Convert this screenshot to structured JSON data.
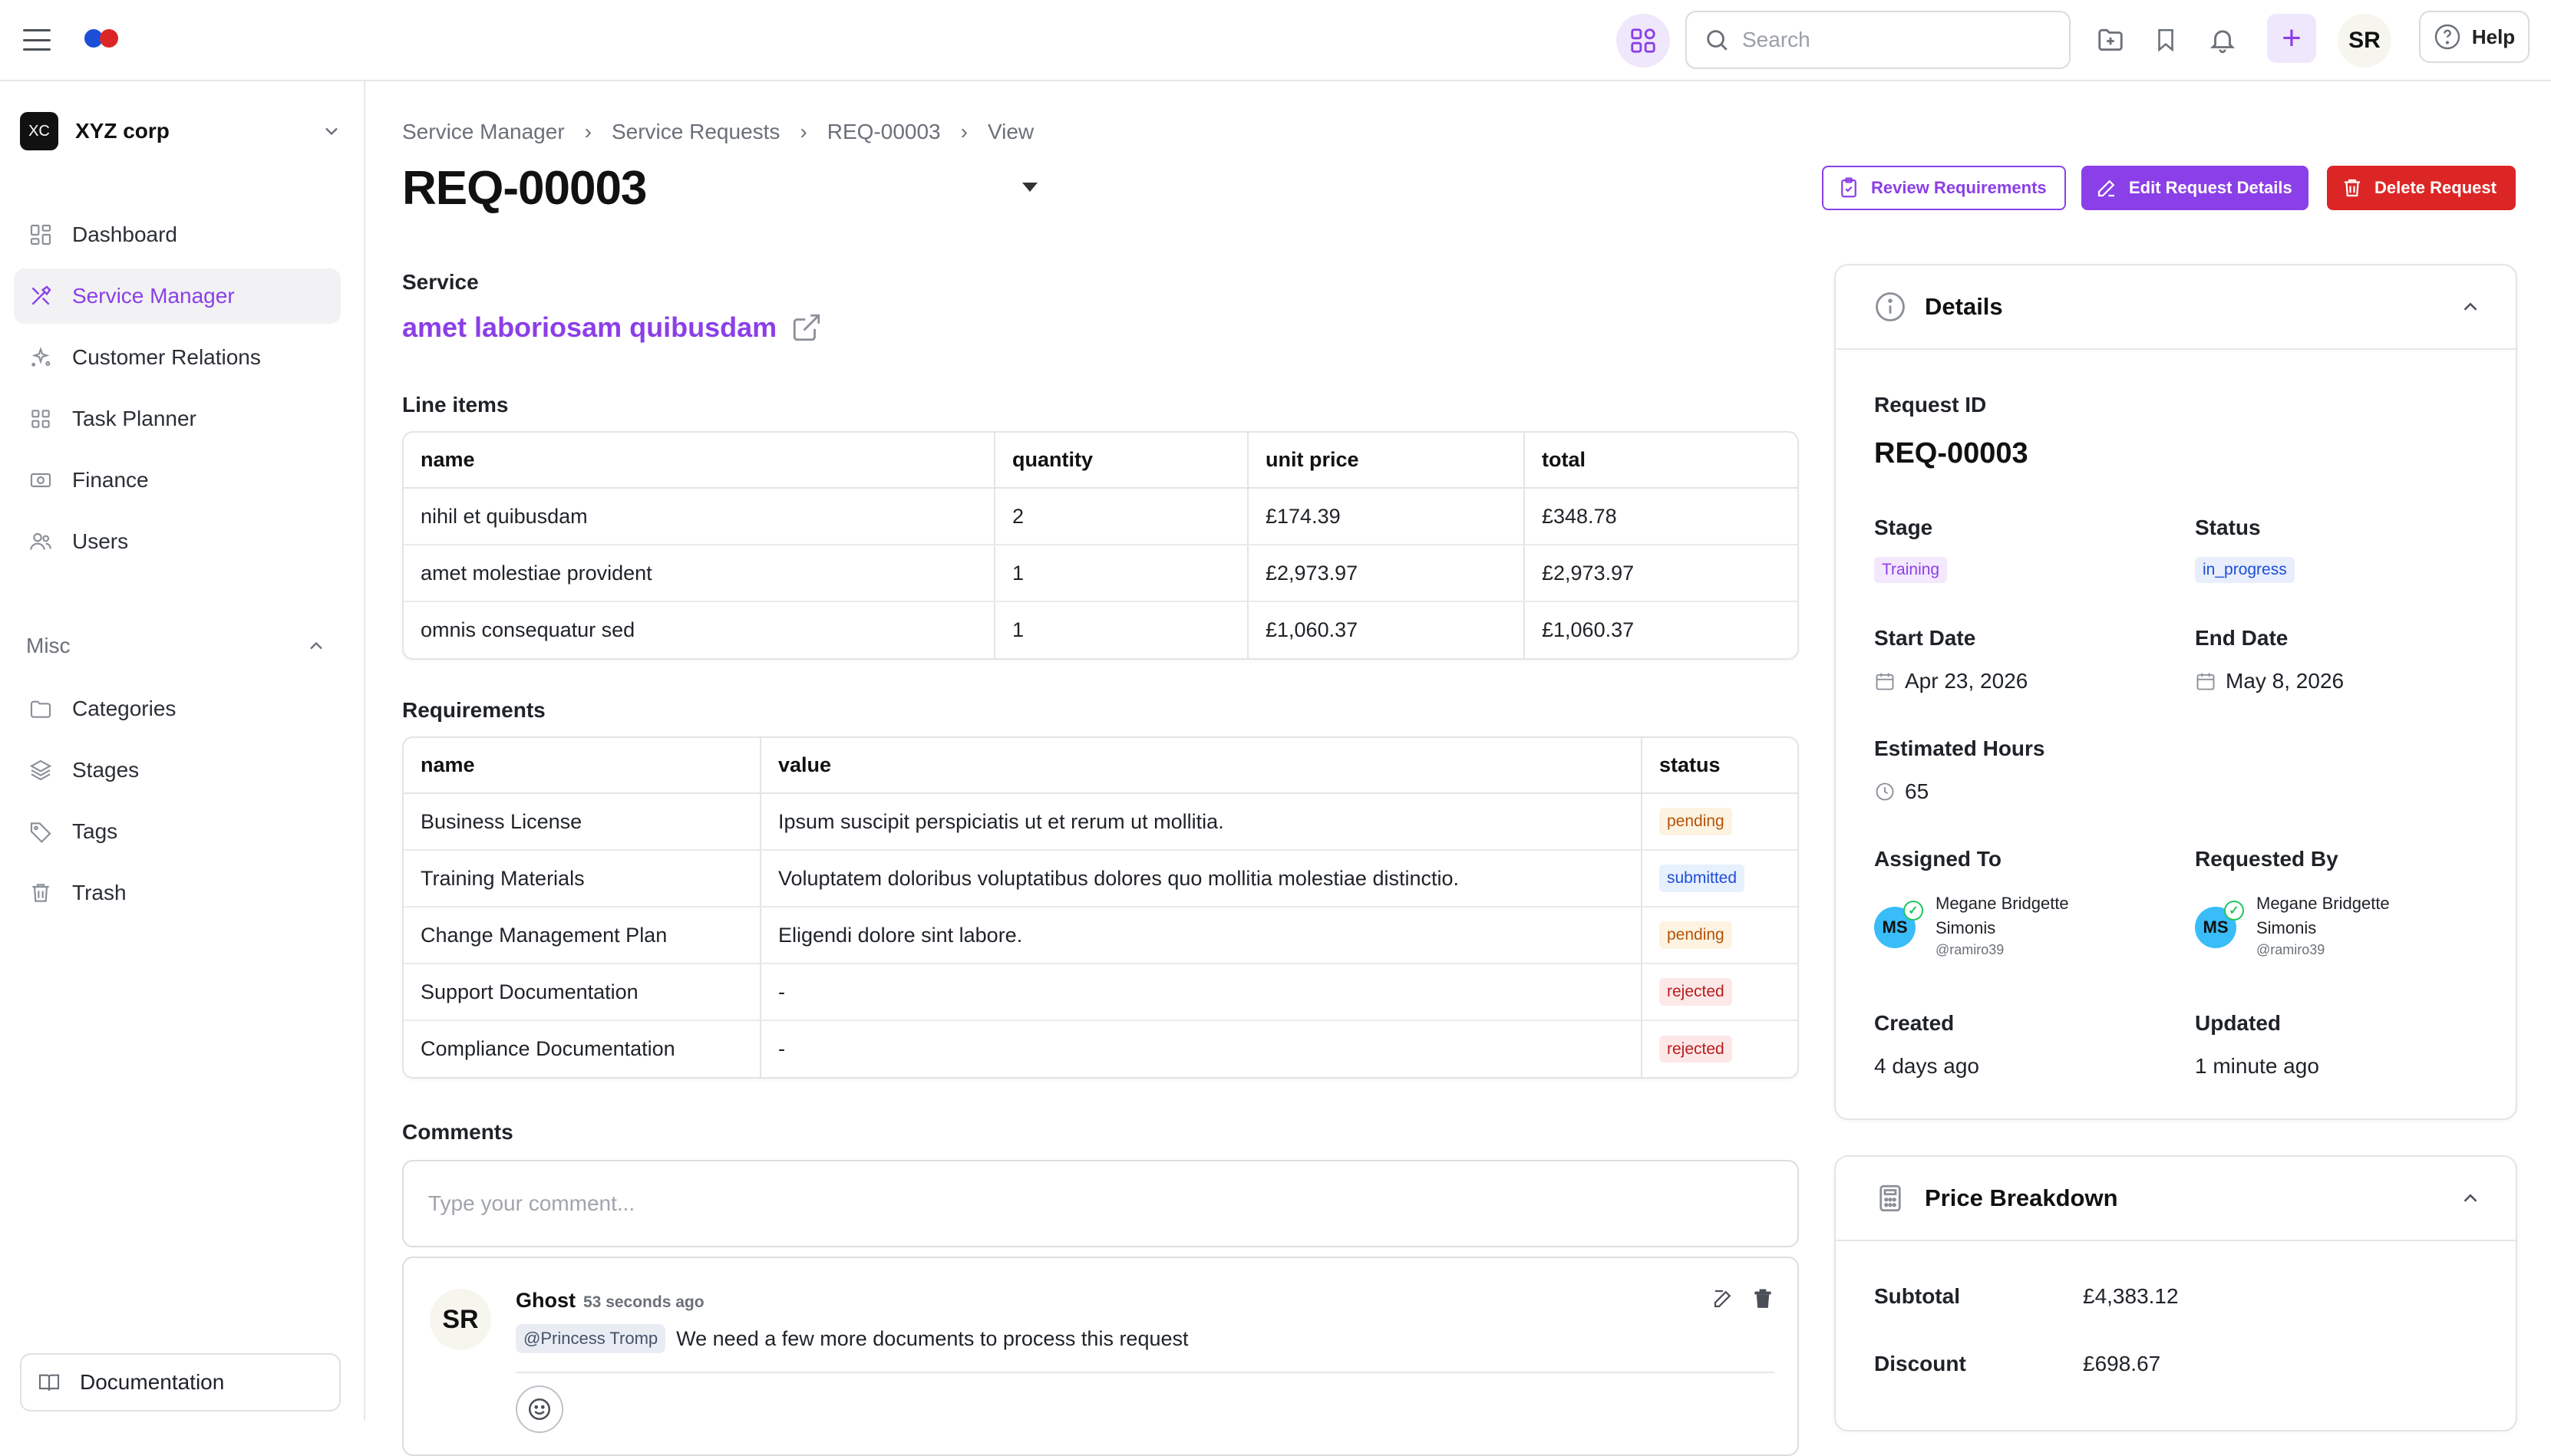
{
  "topbar": {
    "search_placeholder": "Search",
    "avatar_initials": "SR",
    "help_label": "Help"
  },
  "sidebar": {
    "org": {
      "initials": "XC",
      "name": "XYZ corp"
    },
    "items": [
      {
        "label": "Dashboard",
        "icon": "dashboard-icon"
      },
      {
        "label": "Service Manager",
        "icon": "tools-icon",
        "active": true
      },
      {
        "label": "Customer Relations",
        "icon": "sparkle-icon"
      },
      {
        "label": "Task Planner",
        "icon": "grid-icon"
      },
      {
        "label": "Finance",
        "icon": "banknote-icon"
      },
      {
        "label": "Users",
        "icon": "users-icon"
      }
    ],
    "misc_label": "Misc",
    "misc_items": [
      {
        "label": "Categories",
        "icon": "folder-icon"
      },
      {
        "label": "Stages",
        "icon": "layers-icon"
      },
      {
        "label": "Tags",
        "icon": "tag-icon"
      },
      {
        "label": "Trash",
        "icon": "trash-icon"
      }
    ],
    "documentation_label": "Documentation"
  },
  "breadcrumb": [
    "Service Manager",
    "Service Requests",
    "REQ-00003",
    "View"
  ],
  "page": {
    "title": "REQ-00003",
    "actions": {
      "review": "Review Requirements",
      "edit": "Edit Request Details",
      "delete": "Delete Request"
    }
  },
  "service": {
    "label": "Service",
    "name": "amet laboriosam quibusdam"
  },
  "line_items": {
    "label": "Line items",
    "columns": [
      "name",
      "quantity",
      "unit price",
      "total"
    ],
    "rows": [
      [
        "nihil et quibusdam",
        "2",
        "£174.39",
        "£348.78"
      ],
      [
        "amet molestiae provident",
        "1",
        "£2,973.97",
        "£2,973.97"
      ],
      [
        "omnis consequatur sed",
        "1",
        "£1,060.37",
        "£1,060.37"
      ]
    ]
  },
  "requirements": {
    "label": "Requirements",
    "columns": [
      "name",
      "value",
      "status"
    ],
    "rows": [
      {
        "name": "Business License",
        "value": "Ipsum suscipit perspiciatis ut et rerum ut mollitia.",
        "status": "pending"
      },
      {
        "name": "Training Materials",
        "value": "Voluptatem doloribus voluptatibus dolores quo mollitia molestiae distinctio.",
        "status": "submitted"
      },
      {
        "name": "Change Management Plan",
        "value": "Eligendi dolore sint labore.",
        "status": "pending"
      },
      {
        "name": "Support Documentation",
        "value": "-",
        "status": "rejected"
      },
      {
        "name": "Compliance Documentation",
        "value": "-",
        "status": "rejected"
      }
    ]
  },
  "comments": {
    "label": "Comments",
    "placeholder": "Type your comment...",
    "items": [
      {
        "initials": "SR",
        "author": "Ghost",
        "time": "53 seconds ago",
        "mention": "@Princess Tromp",
        "text": "We need a few more documents to process this request"
      }
    ]
  },
  "details": {
    "title": "Details",
    "request_id_label": "Request ID",
    "request_id": "REQ-00003",
    "stage_label": "Stage",
    "stage": "Training",
    "status_label": "Status",
    "status": "in_progress",
    "start_date_label": "Start Date",
    "start_date": "Apr 23, 2026",
    "end_date_label": "End Date",
    "end_date": "May 8, 2026",
    "estimated_hours_label": "Estimated Hours",
    "estimated_hours": "65",
    "assigned_to_label": "Assigned To",
    "assigned_to": {
      "initials": "MS",
      "name": "Megane Bridgette Simonis",
      "handle": "@ramiro39"
    },
    "requested_by_label": "Requested By",
    "requested_by": {
      "initials": "MS",
      "name": "Megane Bridgette Simonis",
      "handle": "@ramiro39"
    },
    "created_label": "Created",
    "created": "4 days ago",
    "updated_label": "Updated",
    "updated": "1 minute ago"
  },
  "price_breakdown": {
    "title": "Price Breakdown",
    "subtotal_label": "Subtotal",
    "subtotal": "£4,383.12",
    "discount_label": "Discount",
    "discount": "£698.67"
  },
  "colors": {
    "accent": "#8b3fe8",
    "danger": "#dc2626",
    "border": "#e3e4e8"
  }
}
